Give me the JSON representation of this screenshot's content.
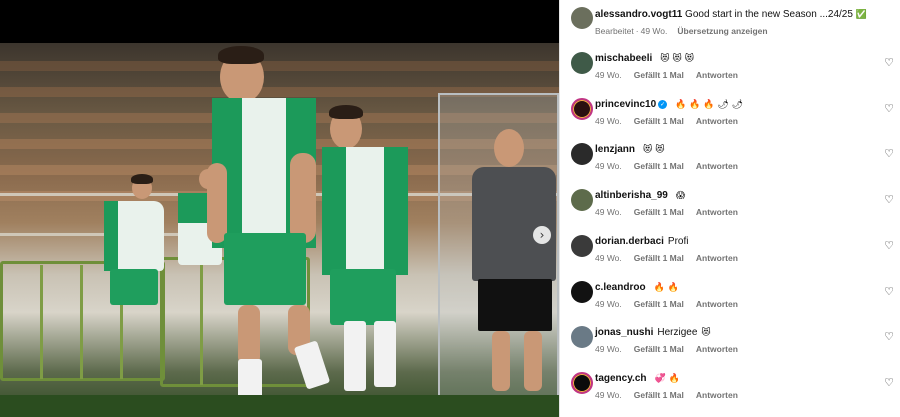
{
  "caption": {
    "username": "alessandro.vogt11",
    "text": "Good start in the new Season ...24/25",
    "check_emoji": "✅",
    "edited": "Bearbeitet",
    "separator": "·",
    "age": "49 Wo.",
    "translate": "Übersetzung anzeigen"
  },
  "labels": {
    "likes": "Gefällt 1 Mal",
    "reply": "Antworten"
  },
  "comments": [
    {
      "username": "mischabeeli",
      "text": "",
      "emoji": "😻 😻 😻",
      "age": "49 Wo.",
      "likes": true,
      "verified": false,
      "avatar_color": "#3f5a48"
    },
    {
      "username": "princevinc10",
      "text": "",
      "emoji": "🔥 🔥 🔥 🌶 🌶",
      "age": "49 Wo.",
      "likes": true,
      "verified": true,
      "avatar_color": "#2b1010"
    },
    {
      "username": "lenzjann",
      "text": "",
      "emoji": "😻 😻",
      "age": "49 Wo.",
      "likes": true,
      "verified": false,
      "avatar_color": "#2a2a2a"
    },
    {
      "username": "altinberisha_99",
      "text": "",
      "emoji": "😱",
      "age": "49 Wo.",
      "likes": true,
      "verified": false,
      "avatar_color": "#5d6b4b"
    },
    {
      "username": "dorian.derbaci",
      "text": "Profi",
      "emoji": "",
      "age": "49 Wo.",
      "likes": true,
      "verified": false,
      "avatar_color": "#3a3a3a"
    },
    {
      "username": "c.leandroo",
      "text": "",
      "emoji": "🔥 🔥",
      "age": "49 Wo.",
      "likes": true,
      "verified": false,
      "avatar_color": "#121212"
    },
    {
      "username": "jonas_nushi",
      "text": "Herzigee",
      "emoji": "😻",
      "age": "49 Wo.",
      "likes": true,
      "verified": false,
      "avatar_color": "#6a7a86"
    },
    {
      "username": "tagency.ch",
      "text": "",
      "emoji": "💞 🔥",
      "age": "49 Wo.",
      "likes": true,
      "verified": false,
      "avatar_color": "#0b0b0b"
    }
  ],
  "icons": {
    "heart": "heart-icon",
    "next": "chevron-right-icon"
  }
}
